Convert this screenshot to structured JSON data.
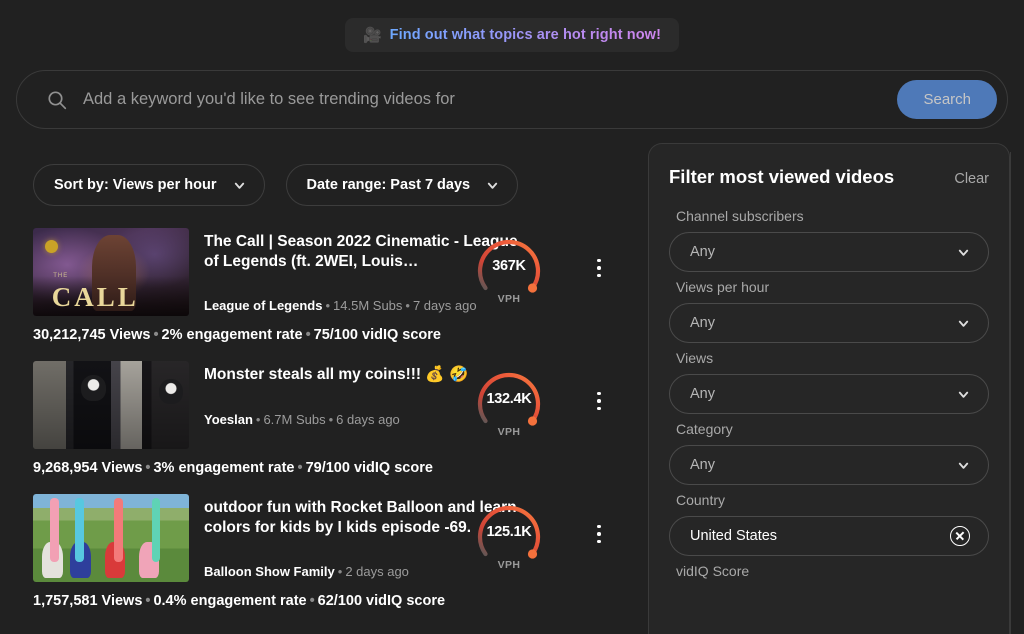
{
  "banner": {
    "icon": "movie-camera-emoji",
    "emoji": "🎥",
    "text": "Find out what topics are hot right now!"
  },
  "search": {
    "icon": "search-icon",
    "placeholder": "Add a keyword you'd like to see trending videos for",
    "value": "",
    "button_label": "Search"
  },
  "toolbar": {
    "sort": {
      "label": "Sort by: Views per hour",
      "icon": "chevron-down-icon"
    },
    "date": {
      "label": "Date range: Past 7 days",
      "icon": "chevron-down-icon"
    }
  },
  "results": [
    {
      "title": "The Call | Season 2022 Cinematic - League of Legends (ft. 2WEI, Louis…",
      "channel": "League of Legends",
      "subs": "14.5M Subs",
      "published": "7 days ago",
      "views": "30,212,745 Views",
      "engagement": "2% engagement rate",
      "vidiq_score": "75/100 vidIQ score",
      "vph_value": "367K",
      "vph_label": "VPH",
      "vph_percent": 86
    },
    {
      "title": "Monster steals all my coins!!! 💰 🤣",
      "channel": "Yoeslan",
      "subs": "6.7M Subs",
      "published": "6 days ago",
      "views": "9,268,954 Views",
      "engagement": "3% engagement rate",
      "vidiq_score": "79/100 vidIQ score",
      "vph_value": "132.4K",
      "vph_label": "VPH",
      "vph_percent": 82
    },
    {
      "title": "outdoor fun with Rocket Balloon and learn colors for kids by I kids episode -69.",
      "channel": "Balloon Show Family",
      "subs": "",
      "published": "2 days ago",
      "views": "1,757,581 Views",
      "engagement": "0.4% engagement rate",
      "vidiq_score": "62/100 vidIQ score",
      "vph_value": "125.1K",
      "vph_label": "VPH",
      "vph_percent": 82
    }
  ],
  "filter_panel": {
    "title": "Filter most viewed videos",
    "clear_label": "Clear",
    "groups": [
      {
        "label": "Channel subscribers",
        "value": "Any",
        "active": false
      },
      {
        "label": "Views per hour",
        "value": "Any",
        "active": false
      },
      {
        "label": "Views",
        "value": "Any",
        "active": false
      },
      {
        "label": "Category",
        "value": "Any",
        "active": false
      },
      {
        "label": "Country",
        "value": "United States",
        "active": true
      },
      {
        "label": "vidIQ Score",
        "value": "",
        "active": false
      }
    ]
  },
  "colors": {
    "background": "#212121",
    "panel": "#262626",
    "accent_blue": "#4e79b8",
    "gauge_start": "#5a5a5a",
    "gauge_mid": "#e0453a",
    "gauge_end": "#f4713c",
    "muted_text": "#9a9a9a"
  }
}
